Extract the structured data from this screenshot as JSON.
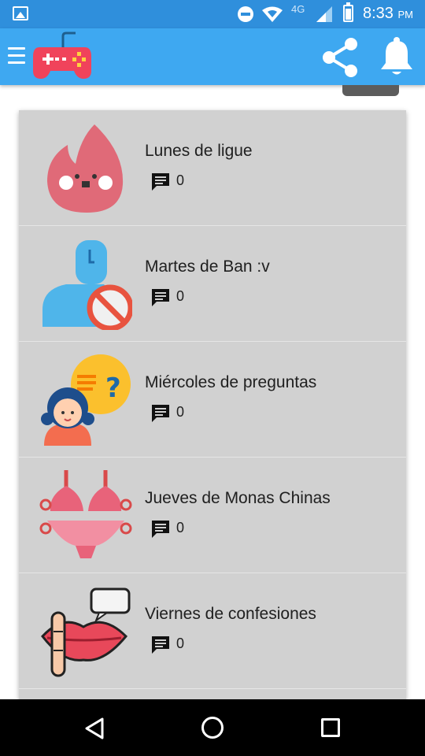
{
  "status_bar": {
    "network": "4G",
    "time": "8:33",
    "ampm": "PM"
  },
  "app_bar": {
    "menu_icon": "hamburger-menu-icon",
    "logo_icon": "gamepad-logo-icon",
    "share_icon": "share-icon",
    "notification_icon": "bell-icon"
  },
  "list": {
    "items": [
      {
        "title": "Lunes de ligue",
        "comments": "0",
        "icon": "flame-icon"
      },
      {
        "title": "Martes de Ban :v",
        "comments": "0",
        "icon": "banned-user-icon"
      },
      {
        "title": "Miércoles de preguntas",
        "comments": "0",
        "icon": "question-girl-icon"
      },
      {
        "title": "Jueves de Monas Chinas",
        "comments": "0",
        "icon": "bikini-icon"
      },
      {
        "title": "Viernes de confesiones",
        "comments": "0",
        "icon": "lips-secret-icon"
      }
    ]
  },
  "colors": {
    "status_bar": "#2f8fdc",
    "app_bar": "#3ea8f1",
    "list_bg": "#d1d1d1"
  }
}
